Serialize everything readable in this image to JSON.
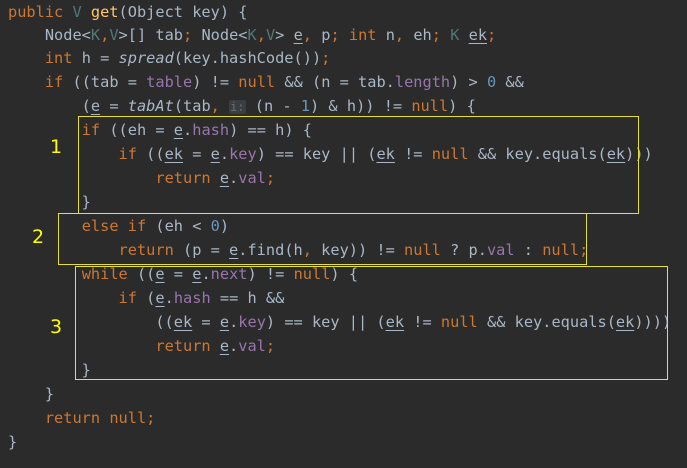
{
  "code": {
    "lines": [
      {
        "segments": [
          {
            "text": "public ",
            "cls": "t-kw"
          },
          {
            "text": "V ",
            "cls": "t-tp"
          },
          {
            "text": "get",
            "cls": "t-fn"
          },
          {
            "text": "(Object key) {",
            "cls": "t-plain"
          }
        ]
      },
      {
        "segments": [
          {
            "text": "    Node<",
            "cls": "t-plain"
          },
          {
            "text": "K",
            "cls": "t-tp"
          },
          {
            "text": ",",
            "cls": "t-kw"
          },
          {
            "text": "V",
            "cls": "t-tp"
          },
          {
            "text": ">[] tab",
            "cls": "t-plain"
          },
          {
            "text": "; ",
            "cls": "t-kw"
          },
          {
            "text": "Node<",
            "cls": "t-plain"
          },
          {
            "text": "K",
            "cls": "t-tp"
          },
          {
            "text": ",",
            "cls": "t-kw"
          },
          {
            "text": "V",
            "cls": "t-tp"
          },
          {
            "text": "> ",
            "cls": "t-plain"
          },
          {
            "text": "e",
            "cls": "t-plain t-ul"
          },
          {
            "text": ", ",
            "cls": "t-kw"
          },
          {
            "text": "p",
            "cls": "t-plain"
          },
          {
            "text": "; ",
            "cls": "t-kw"
          },
          {
            "text": "int ",
            "cls": "t-kw"
          },
          {
            "text": "n",
            "cls": "t-plain"
          },
          {
            "text": ", ",
            "cls": "t-kw"
          },
          {
            "text": "eh",
            "cls": "t-plain"
          },
          {
            "text": "; ",
            "cls": "t-kw"
          },
          {
            "text": "K ",
            "cls": "t-tp"
          },
          {
            "text": "ek",
            "cls": "t-plain t-ul"
          },
          {
            "text": ";",
            "cls": "t-kw"
          }
        ]
      },
      {
        "segments": [
          {
            "text": "    ",
            "cls": "t-plain"
          },
          {
            "text": "int ",
            "cls": "t-kw"
          },
          {
            "text": "h = ",
            "cls": "t-plain"
          },
          {
            "text": "spread",
            "cls": "t-plain t-it"
          },
          {
            "text": "(key.hashCode())",
            "cls": "t-plain"
          },
          {
            "text": ";",
            "cls": "t-kw"
          }
        ]
      },
      {
        "segments": [
          {
            "text": "    ",
            "cls": "t-plain"
          },
          {
            "text": "if ",
            "cls": "t-kw"
          },
          {
            "text": "((tab = ",
            "cls": "t-plain"
          },
          {
            "text": "table",
            "cls": "t-fld"
          },
          {
            "text": ") != ",
            "cls": "t-plain"
          },
          {
            "text": "null ",
            "cls": "t-kw"
          },
          {
            "text": "&& (n = tab.",
            "cls": "t-plain"
          },
          {
            "text": "length",
            "cls": "t-fld"
          },
          {
            "text": ") > ",
            "cls": "t-plain"
          },
          {
            "text": "0 ",
            "cls": "t-num"
          },
          {
            "text": "&&",
            "cls": "t-plain"
          }
        ]
      },
      {
        "segments": [
          {
            "text": "        (",
            "cls": "t-plain"
          },
          {
            "text": "e",
            "cls": "t-plain t-ul"
          },
          {
            "text": " = ",
            "cls": "t-plain"
          },
          {
            "text": "tabAt",
            "cls": "t-plain t-it"
          },
          {
            "text": "(tab",
            "cls": "t-plain"
          },
          {
            "text": ", ",
            "cls": "t-kw"
          },
          {
            "text": "i:",
            "cls": "t-hint"
          },
          {
            "text": " (n - ",
            "cls": "t-plain"
          },
          {
            "text": "1",
            "cls": "t-num"
          },
          {
            "text": ") & h)) != ",
            "cls": "t-plain"
          },
          {
            "text": "null",
            "cls": "t-kw"
          },
          {
            "text": ") {",
            "cls": "t-plain"
          }
        ]
      },
      {
        "segments": [
          {
            "text": "        ",
            "cls": "t-plain"
          },
          {
            "text": "if ",
            "cls": "t-kw"
          },
          {
            "text": "((eh = ",
            "cls": "t-plain"
          },
          {
            "text": "e",
            "cls": "t-plain t-ul"
          },
          {
            "text": ".",
            "cls": "t-plain"
          },
          {
            "text": "hash",
            "cls": "t-fld"
          },
          {
            "text": ") == h) {",
            "cls": "t-plain"
          }
        ]
      },
      {
        "segments": [
          {
            "text": "            ",
            "cls": "t-plain"
          },
          {
            "text": "if ",
            "cls": "t-kw"
          },
          {
            "text": "((",
            "cls": "t-plain"
          },
          {
            "text": "ek",
            "cls": "t-plain t-ul"
          },
          {
            "text": " = ",
            "cls": "t-plain"
          },
          {
            "text": "e",
            "cls": "t-plain t-ul"
          },
          {
            "text": ".",
            "cls": "t-plain"
          },
          {
            "text": "key",
            "cls": "t-fld"
          },
          {
            "text": ") == key || (",
            "cls": "t-plain"
          },
          {
            "text": "ek",
            "cls": "t-plain t-ul"
          },
          {
            "text": " != ",
            "cls": "t-plain"
          },
          {
            "text": "null ",
            "cls": "t-kw"
          },
          {
            "text": "&& key.equals(",
            "cls": "t-plain"
          },
          {
            "text": "ek",
            "cls": "t-plain t-ul"
          },
          {
            "text": ")))",
            "cls": "t-plain"
          }
        ]
      },
      {
        "segments": [
          {
            "text": "                ",
            "cls": "t-plain"
          },
          {
            "text": "return ",
            "cls": "t-kw"
          },
          {
            "text": "e",
            "cls": "t-plain t-ul"
          },
          {
            "text": ".",
            "cls": "t-plain"
          },
          {
            "text": "val",
            "cls": "t-fld"
          },
          {
            "text": ";",
            "cls": "t-kw"
          }
        ]
      },
      {
        "segments": [
          {
            "text": "        }",
            "cls": "t-plain"
          }
        ]
      },
      {
        "segments": [
          {
            "text": "        ",
            "cls": "t-plain"
          },
          {
            "text": "else if ",
            "cls": "t-kw"
          },
          {
            "text": "(eh < ",
            "cls": "t-plain"
          },
          {
            "text": "0",
            "cls": "t-num"
          },
          {
            "text": ")",
            "cls": "t-plain"
          }
        ]
      },
      {
        "segments": [
          {
            "text": "            ",
            "cls": "t-plain"
          },
          {
            "text": "return ",
            "cls": "t-kw"
          },
          {
            "text": "(p = ",
            "cls": "t-plain"
          },
          {
            "text": "e",
            "cls": "t-plain t-ul"
          },
          {
            "text": ".find(h",
            "cls": "t-plain"
          },
          {
            "text": ", ",
            "cls": "t-kw"
          },
          {
            "text": "key)) != ",
            "cls": "t-plain"
          },
          {
            "text": "null ",
            "cls": "t-kw"
          },
          {
            "text": "? p.",
            "cls": "t-plain"
          },
          {
            "text": "val ",
            "cls": "t-fld"
          },
          {
            "text": ": ",
            "cls": "t-plain"
          },
          {
            "text": "null",
            "cls": "t-kw"
          },
          {
            "text": ";",
            "cls": "t-kw"
          }
        ]
      },
      {
        "segments": [
          {
            "text": "        ",
            "cls": "t-plain"
          },
          {
            "text": "while ",
            "cls": "t-kw"
          },
          {
            "text": "((",
            "cls": "t-plain"
          },
          {
            "text": "e",
            "cls": "t-plain t-ul"
          },
          {
            "text": " = ",
            "cls": "t-plain"
          },
          {
            "text": "e",
            "cls": "t-plain t-ul"
          },
          {
            "text": ".",
            "cls": "t-plain"
          },
          {
            "text": "next",
            "cls": "t-fld"
          },
          {
            "text": ") != ",
            "cls": "t-plain"
          },
          {
            "text": "null",
            "cls": "t-kw"
          },
          {
            "text": ") {",
            "cls": "t-plain"
          }
        ]
      },
      {
        "segments": [
          {
            "text": "            ",
            "cls": "t-plain"
          },
          {
            "text": "if ",
            "cls": "t-kw"
          },
          {
            "text": "(",
            "cls": "t-plain"
          },
          {
            "text": "e",
            "cls": "t-plain t-ul"
          },
          {
            "text": ".",
            "cls": "t-plain"
          },
          {
            "text": "hash",
            "cls": "t-fld"
          },
          {
            "text": " == h &&",
            "cls": "t-plain"
          }
        ]
      },
      {
        "segments": [
          {
            "text": "                ((",
            "cls": "t-plain"
          },
          {
            "text": "ek",
            "cls": "t-plain t-ul"
          },
          {
            "text": " = ",
            "cls": "t-plain"
          },
          {
            "text": "e",
            "cls": "t-plain t-ul"
          },
          {
            "text": ".",
            "cls": "t-plain"
          },
          {
            "text": "key",
            "cls": "t-fld"
          },
          {
            "text": ") == key || (",
            "cls": "t-plain"
          },
          {
            "text": "ek",
            "cls": "t-plain t-ul"
          },
          {
            "text": " != ",
            "cls": "t-plain"
          },
          {
            "text": "null ",
            "cls": "t-kw"
          },
          {
            "text": "&& key.equals(",
            "cls": "t-plain"
          },
          {
            "text": "ek",
            "cls": "t-plain t-ul"
          },
          {
            "text": "))))",
            "cls": "t-plain"
          }
        ]
      },
      {
        "segments": [
          {
            "text": "                ",
            "cls": "t-plain"
          },
          {
            "text": "return ",
            "cls": "t-kw"
          },
          {
            "text": "e",
            "cls": "t-plain t-ul"
          },
          {
            "text": ".",
            "cls": "t-plain"
          },
          {
            "text": "val",
            "cls": "t-fld"
          },
          {
            "text": ";",
            "cls": "t-kw"
          }
        ]
      },
      {
        "segments": [
          {
            "text": "        }",
            "cls": "t-plain"
          }
        ]
      },
      {
        "segments": [
          {
            "text": "    }",
            "cls": "t-plain"
          }
        ]
      },
      {
        "segments": [
          {
            "text": "    ",
            "cls": "t-plain"
          },
          {
            "text": "return ",
            "cls": "t-kw"
          },
          {
            "text": "null",
            "cls": "t-kw"
          },
          {
            "text": ";",
            "cls": "t-kw"
          }
        ]
      },
      {
        "segments": [
          {
            "text": "}",
            "cls": "t-plain"
          }
        ]
      }
    ]
  },
  "annotations": {
    "marker_1": "1",
    "marker_2": "2",
    "marker_3": "3",
    "box_color": "#e5df3a",
    "marker_color": "#ffff00"
  },
  "theme": {
    "background": "#2b2b2b",
    "keyword": "#cc7832",
    "method": "#ffc66d",
    "field": "#9876aa",
    "number": "#6897bb",
    "type_param": "#507874",
    "text": "#a9b7c6"
  }
}
